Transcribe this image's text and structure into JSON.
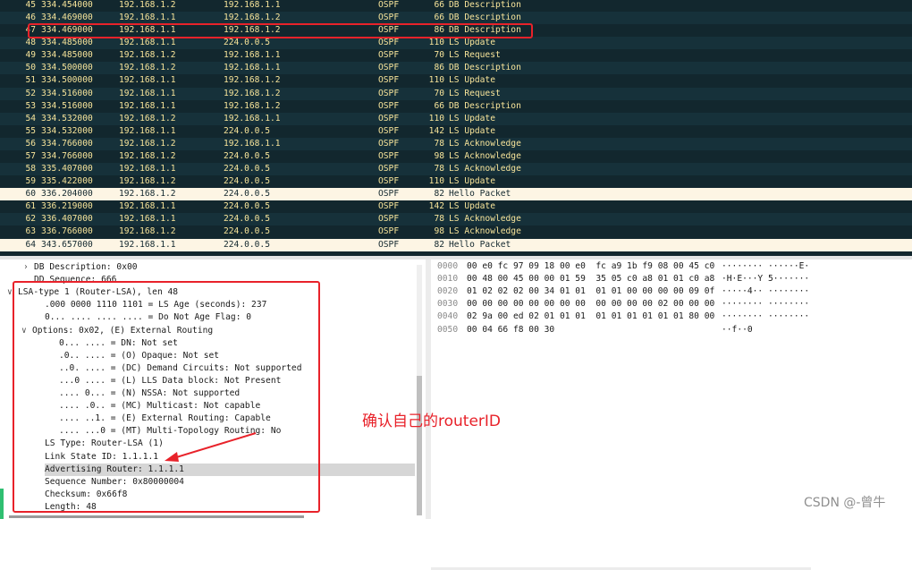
{
  "packet_list": {
    "rows": [
      {
        "no": "45",
        "time": "334.454000",
        "src": "192.168.1.2",
        "dst": "192.168.1.1",
        "proto": "OSPF",
        "len": "66",
        "info": "DB Description"
      },
      {
        "no": "46",
        "time": "334.469000",
        "src": "192.168.1.1",
        "dst": "192.168.1.2",
        "proto": "OSPF",
        "len": "66",
        "info": "DB Description"
      },
      {
        "no": "47",
        "time": "334.469000",
        "src": "192.168.1.1",
        "dst": "192.168.1.2",
        "proto": "OSPF",
        "len": "86",
        "info": "DB Description"
      },
      {
        "no": "48",
        "time": "334.485000",
        "src": "192.168.1.1",
        "dst": "224.0.0.5",
        "proto": "OSPF",
        "len": "110",
        "info": "LS Update"
      },
      {
        "no": "49",
        "time": "334.485000",
        "src": "192.168.1.2",
        "dst": "192.168.1.1",
        "proto": "OSPF",
        "len": "70",
        "info": "LS Request"
      },
      {
        "no": "50",
        "time": "334.500000",
        "src": "192.168.1.2",
        "dst": "192.168.1.1",
        "proto": "OSPF",
        "len": "86",
        "info": "DB Description"
      },
      {
        "no": "51",
        "time": "334.500000",
        "src": "192.168.1.1",
        "dst": "192.168.1.2",
        "proto": "OSPF",
        "len": "110",
        "info": "LS Update"
      },
      {
        "no": "52",
        "time": "334.516000",
        "src": "192.168.1.1",
        "dst": "192.168.1.2",
        "proto": "OSPF",
        "len": "70",
        "info": "LS Request"
      },
      {
        "no": "53",
        "time": "334.516000",
        "src": "192.168.1.1",
        "dst": "192.168.1.2",
        "proto": "OSPF",
        "len": "66",
        "info": "DB Description"
      },
      {
        "no": "54",
        "time": "334.532000",
        "src": "192.168.1.2",
        "dst": "192.168.1.1",
        "proto": "OSPF",
        "len": "110",
        "info": "LS Update"
      },
      {
        "no": "55",
        "time": "334.532000",
        "src": "192.168.1.1",
        "dst": "224.0.0.5",
        "proto": "OSPF",
        "len": "142",
        "info": "LS Update"
      },
      {
        "no": "56",
        "time": "334.766000",
        "src": "192.168.1.2",
        "dst": "192.168.1.1",
        "proto": "OSPF",
        "len": "78",
        "info": "LS Acknowledge"
      },
      {
        "no": "57",
        "time": "334.766000",
        "src": "192.168.1.2",
        "dst": "224.0.0.5",
        "proto": "OSPF",
        "len": "98",
        "info": "LS Acknowledge"
      },
      {
        "no": "58",
        "time": "335.407000",
        "src": "192.168.1.1",
        "dst": "224.0.0.5",
        "proto": "OSPF",
        "len": "78",
        "info": "LS Acknowledge"
      },
      {
        "no": "59",
        "time": "335.422000",
        "src": "192.168.1.2",
        "dst": "224.0.0.5",
        "proto": "OSPF",
        "len": "110",
        "info": "LS Update"
      },
      {
        "no": "60",
        "time": "336.204000",
        "src": "192.168.1.2",
        "dst": "224.0.0.5",
        "proto": "OSPF",
        "len": "82",
        "info": "Hello Packet"
      },
      {
        "no": "61",
        "time": "336.219000",
        "src": "192.168.1.1",
        "dst": "224.0.0.5",
        "proto": "OSPF",
        "len": "142",
        "info": "LS Update"
      },
      {
        "no": "62",
        "time": "336.407000",
        "src": "192.168.1.1",
        "dst": "224.0.0.5",
        "proto": "OSPF",
        "len": "78",
        "info": "LS Acknowledge"
      },
      {
        "no": "63",
        "time": "336.766000",
        "src": "192.168.1.2",
        "dst": "224.0.0.5",
        "proto": "OSPF",
        "len": "98",
        "info": "LS Acknowledge"
      },
      {
        "no": "64",
        "time": "343.657000",
        "src": "192.168.1.1",
        "dst": "224.0.0.5",
        "proto": "OSPF",
        "len": "82",
        "info": "Hello Packet"
      }
    ]
  },
  "details": {
    "lines": [
      {
        "text": "DB Description: 0x00",
        "toggle": ">"
      },
      {
        "text": "DD Sequence: 666",
        "toggle": ""
      },
      {
        "text": "LSA-type 1 (Router-LSA), len 48",
        "toggle": "v"
      },
      {
        "text": ".000 0000 1110 1101 = LS Age (seconds): 237",
        "toggle": ""
      },
      {
        "text": "0... .... .... .... = Do Not Age Flag: 0",
        "toggle": ""
      },
      {
        "text": "Options: 0x02, (E) External Routing",
        "toggle": "v"
      },
      {
        "text": "0... .... = DN: Not set",
        "toggle": ""
      },
      {
        "text": ".0.. .... = (O) Opaque: Not set",
        "toggle": ""
      },
      {
        "text": "..0. .... = (DC) Demand Circuits: Not supported",
        "toggle": ""
      },
      {
        "text": "...0 .... = (L) LLS Data block: Not Present",
        "toggle": ""
      },
      {
        "text": ".... 0... = (N) NSSA: Not supported",
        "toggle": ""
      },
      {
        "text": ".... .0.. = (MC) Multicast: Not capable",
        "toggle": ""
      },
      {
        "text": ".... ..1. = (E) External Routing: Capable",
        "toggle": ""
      },
      {
        "text": ".... ...0 = (MT) Multi-Topology Routing: No",
        "toggle": ""
      },
      {
        "text": "LS Type: Router-LSA (1)",
        "toggle": ""
      },
      {
        "text": "Link State ID: 1.1.1.1",
        "toggle": ""
      },
      {
        "text": "Advertising Router: 1.1.1.1",
        "toggle": ""
      },
      {
        "text": "Sequence Number: 0x80000004",
        "toggle": ""
      },
      {
        "text": "Checksum: 0x66f8",
        "toggle": ""
      },
      {
        "text": "Length: 48",
        "toggle": ""
      }
    ]
  },
  "bytes": {
    "rows": [
      {
        "offset": "0000",
        "hex": "00 e0 fc 97 09 18 00 e0  fc a9 1b f9 08 00 45 c0",
        "ascii": "········ ······E·"
      },
      {
        "offset": "0010",
        "hex": "00 48 00 45 00 00 01 59  35 05 c0 a8 01 01 c0 a8",
        "ascii": "·H·E···Y 5·······"
      },
      {
        "offset": "0020",
        "hex": "01 02 02 02 00 34 01 01  01 01 00 00 00 00 09 0f",
        "ascii": "·····4·· ········"
      },
      {
        "offset": "0030",
        "hex": "00 00 00 00 00 00 00 00  00 00 00 00 02 00 00 00",
        "ascii": "········ ········"
      },
      {
        "offset": "0040",
        "hex": "02 9a 00 ed 02 01 01 01  01 01 01 01 01 01 80 00",
        "ascii": "········ ········"
      },
      {
        "offset": "0050",
        "hex": "00 04 66 f8 00 30",
        "ascii": "··f··0"
      }
    ]
  },
  "annotation": {
    "text": "确认自己的routerID"
  },
  "watermark": {
    "text": "CSDN @-曾牛"
  },
  "colors": {
    "accent_red": "#e8222a",
    "list_bg": "#12272e",
    "list_text": "#f7e49a",
    "hello_bg": "#fdf5e4"
  }
}
